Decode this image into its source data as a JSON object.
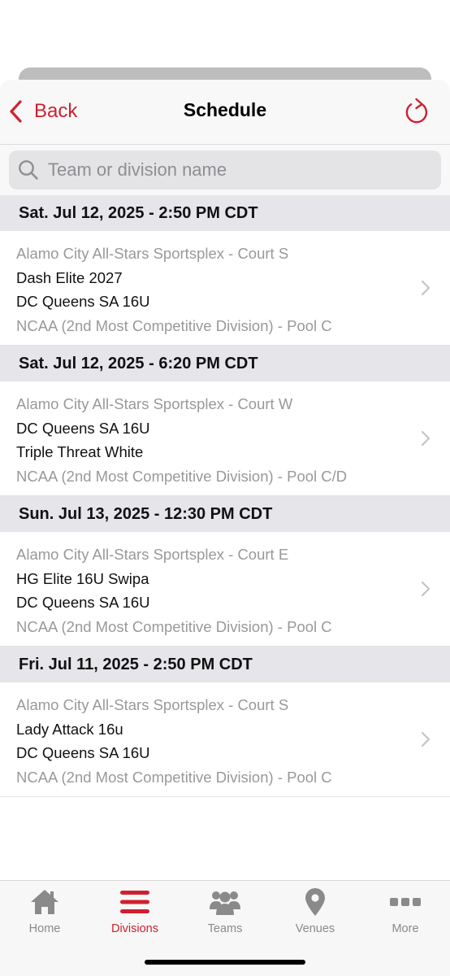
{
  "colors": {
    "accent": "#d0202f",
    "section_bg": "#e5e5ea",
    "secondary_text": "#999999",
    "tab_inactive": "#8a8a8a"
  },
  "header": {
    "back_label": "Back",
    "title": "Schedule",
    "back_icon": "chevron-left-icon",
    "refresh_icon": "refresh-icon"
  },
  "search": {
    "placeholder": "Team or division name",
    "value": "",
    "icon": "search-icon"
  },
  "schedule": [
    {
      "datetime": "Sat. Jul 12, 2025 - 2:50 PM CDT",
      "venue": "Alamo City All-Stars Sportsplex - Court S",
      "team1": "Dash Elite 2027",
      "team2": "DC Queens SA 16U",
      "division": "NCAA (2nd Most Competitive Division) - Pool C"
    },
    {
      "datetime": "Sat. Jul 12, 2025 - 6:20 PM CDT",
      "venue": "Alamo City All-Stars Sportsplex - Court W",
      "team1": "DC Queens SA 16U",
      "team2": "Triple Threat White",
      "division": "NCAA (2nd Most Competitive Division) - Pool C/D"
    },
    {
      "datetime": "Sun. Jul 13, 2025 - 12:30 PM CDT",
      "venue": "Alamo City All-Stars Sportsplex - Court E",
      "team1": "HG Elite 16U Swipa",
      "team2": "DC Queens SA 16U",
      "division": "NCAA (2nd Most Competitive Division) - Pool C"
    },
    {
      "datetime": "Fri. Jul 11, 2025 - 2:50 PM CDT",
      "venue": "Alamo City All-Stars Sportsplex - Court S",
      "team1": "Lady Attack 16u",
      "team2": "DC Queens SA 16U",
      "division": "NCAA (2nd Most Competitive Division) - Pool C"
    }
  ],
  "tabbar": {
    "active": "Divisions",
    "tabs": [
      {
        "label": "Home",
        "icon": "home-icon"
      },
      {
        "label": "Divisions",
        "icon": "menu-lines-icon"
      },
      {
        "label": "Teams",
        "icon": "people-group-icon"
      },
      {
        "label": "Venues",
        "icon": "location-pin-icon"
      },
      {
        "label": "More",
        "icon": "more-dots-icon"
      }
    ]
  }
}
